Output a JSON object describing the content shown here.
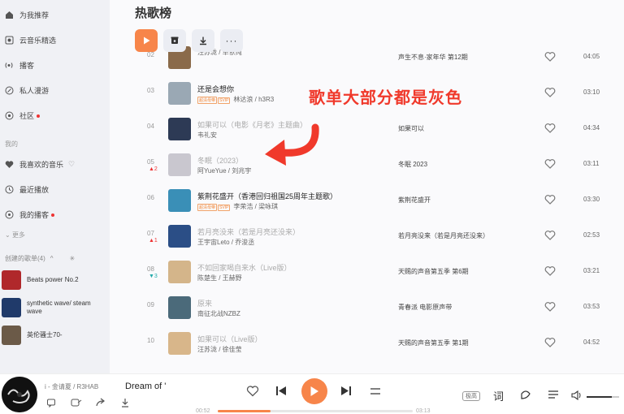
{
  "sidebar": {
    "nav": [
      {
        "label": "为我推荐",
        "icon": "home-icon"
      },
      {
        "label": "云音乐精选",
        "icon": "music-library-icon"
      },
      {
        "label": "播客",
        "icon": "broadcast-icon"
      },
      {
        "label": "私人漫游",
        "icon": "roam-icon"
      },
      {
        "label": "社区",
        "icon": "community-icon",
        "dot": true
      }
    ],
    "section_mine": "我的",
    "mine": [
      {
        "label": "我喜欢的音乐",
        "icon": "heart-icon"
      },
      {
        "label": "最近播放",
        "icon": "clock-icon"
      },
      {
        "label": "我的播客",
        "icon": "podcast-icon",
        "dot": true
      }
    ],
    "more_label": "更多",
    "created_header": "创建的歌单(4)",
    "playlists": [
      {
        "label": "Beats power No.2",
        "color": "#b0282b"
      },
      {
        "label": "synthetic wave/ steam wave",
        "color": "#203a6a"
      },
      {
        "label": "英伦骚士70-",
        "color": "#6b5a48"
      }
    ]
  },
  "header": {
    "title": "热歌榜"
  },
  "annotation": {
    "text": "歌单大部分都是灰色",
    "color": "#f0392b"
  },
  "songs": [
    {
      "rank": "02",
      "delta": "",
      "title": "",
      "grey": false,
      "tags": [],
      "artist": "汪苏泷 / 单依纯",
      "album": "声生不息·家年华 第12期",
      "duration": "04:05",
      "cover": "#8a6a4a"
    },
    {
      "rank": "03",
      "delta": "",
      "title": "还是会想你",
      "grey": false,
      "tags": [
        "超清母带",
        "SVIP"
      ],
      "artist": "林达浪 / h3R3",
      "album": "",
      "duration": "03:10",
      "cover": "#9aa8b4"
    },
    {
      "rank": "04",
      "delta": "",
      "title": "如果可以（电影《月老》主题曲）",
      "grey": true,
      "tags": [],
      "artist": "韦礼安",
      "album": "如果可以",
      "duration": "04:34",
      "cover": "#2d3a55"
    },
    {
      "rank": "05",
      "delta": "▲2",
      "delta_dir": "up",
      "title": "冬眠（2023）",
      "grey": true,
      "tags": [],
      "artist": "阿YueYue / 刘兆宇",
      "album": "冬眠 2023",
      "duration": "03:11",
      "cover": "#c9c7cf"
    },
    {
      "rank": "06",
      "delta": "",
      "title": "紫荆花盛开（香港回归祖国25周年主题歌）",
      "grey": false,
      "tags": [
        "超清母带",
        "SVIP"
      ],
      "artist": "李荣浩 / 梁咏琪",
      "album": "紫荆花盛开",
      "duration": "03:30",
      "cover": "#3a8fb7"
    },
    {
      "rank": "07",
      "delta": "▲1",
      "delta_dir": "up",
      "title": "若月亮没来（若是月亮还没来）",
      "grey": true,
      "tags": [],
      "artist": "王宇宙Leto / 乔浚丞",
      "album": "若月亮没来（若是月亮还没来）",
      "duration": "02:53",
      "cover": "#2b4e86"
    },
    {
      "rank": "08",
      "delta": "▼3",
      "delta_dir": "down",
      "title": "不如回家喝自来水（Live版）",
      "grey": true,
      "tags": [],
      "artist": "陈楚生 / 王赫野",
      "album": "天赐的声音第五季 第6期",
      "duration": "03:21",
      "cover": "#d4b58a"
    },
    {
      "rank": "09",
      "delta": "",
      "title": "原来",
      "grey": true,
      "tags": [],
      "artist": "南征北战NZBZ",
      "album": "青春派 电影原声带",
      "duration": "03:53",
      "cover": "#4b6a7a"
    },
    {
      "rank": "10",
      "delta": "",
      "title": "如果可以（Live版）",
      "grey": true,
      "tags": [],
      "artist": "汪苏泷 / 徐佳莹",
      "album": "天赐的声音第五季 第1期",
      "duration": "04:52",
      "cover": "#d8b68a"
    }
  ],
  "player": {
    "artist_line": "i - 金请夏 / R3HAB",
    "song_title": "Dream of '",
    "time_current": "00:52",
    "time_total": "03:13",
    "progress": 0.27,
    "quality_label": "极高",
    "lyrics_label": "词",
    "accent": "#f7854a"
  }
}
